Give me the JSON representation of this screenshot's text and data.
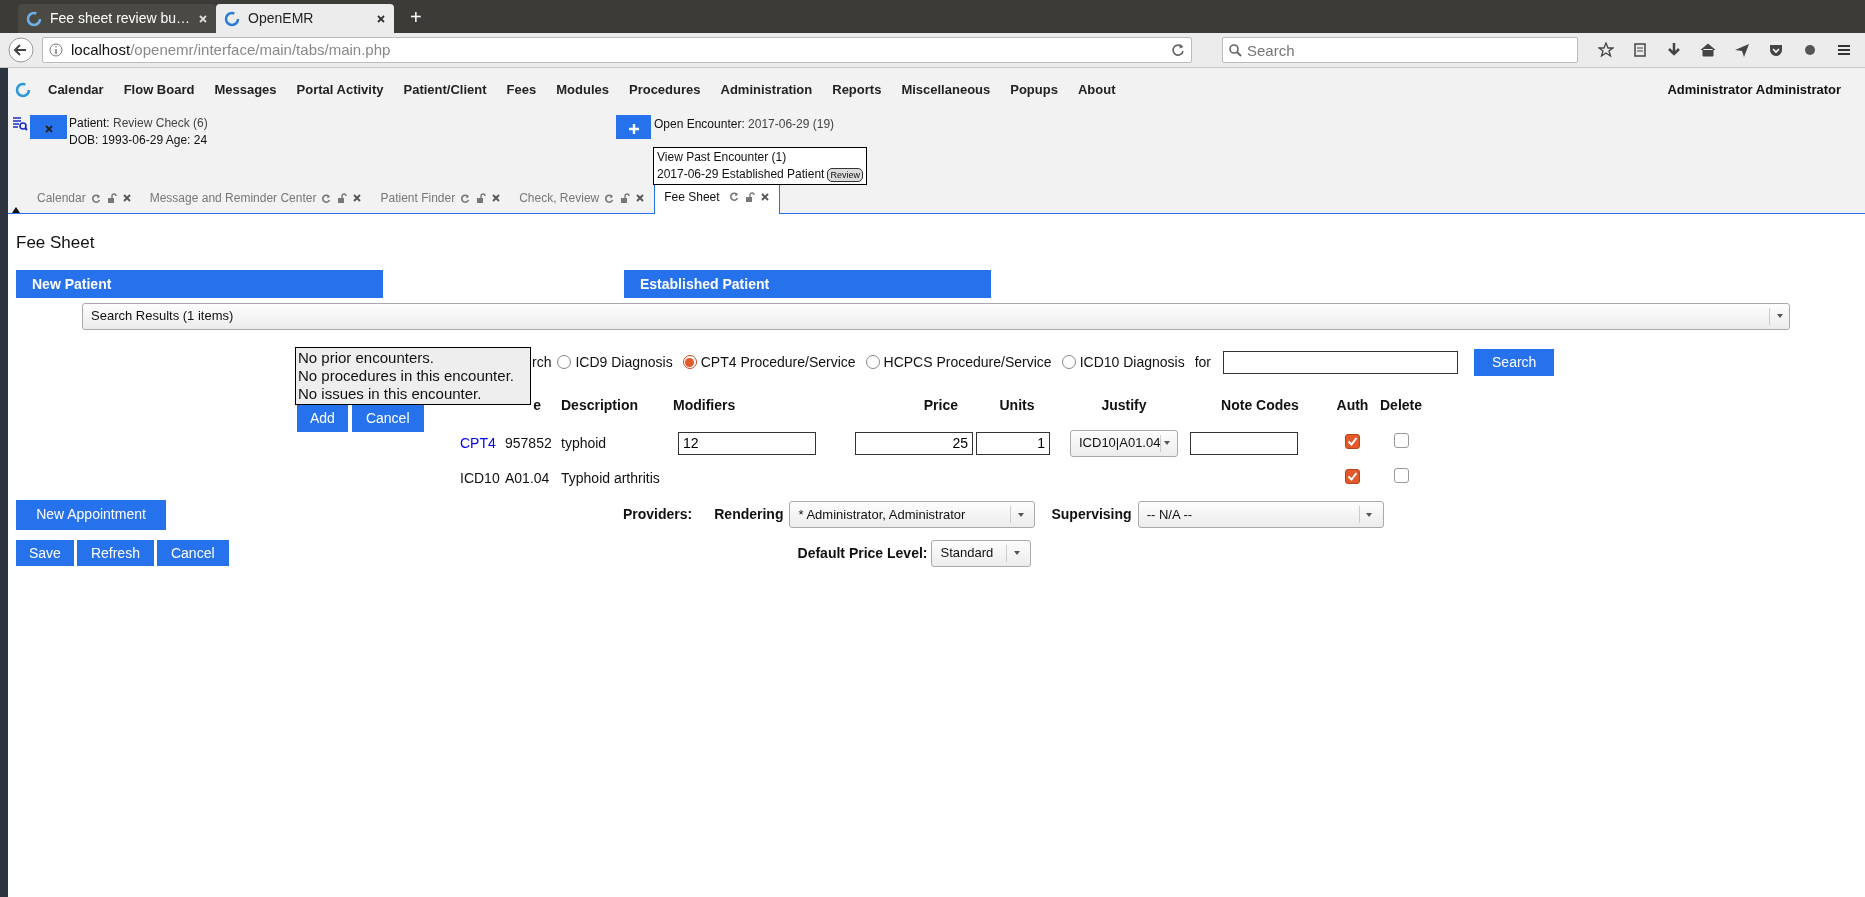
{
  "browser": {
    "tabs": [
      {
        "title": "Fee sheet review bu…",
        "selected": false
      },
      {
        "title": "OpenEMR",
        "selected": true
      }
    ],
    "new_tab": "+",
    "url": {
      "host": "localhost",
      "path": "/openemr/interface/main/tabs/main.php"
    },
    "search": {
      "placeholder": "Search"
    }
  },
  "menu": {
    "items": [
      "Calendar",
      "Flow Board",
      "Messages",
      "Portal Activity",
      "Patient/Client",
      "Fees",
      "Modules",
      "Procedures",
      "Administration",
      "Reports",
      "Miscellaneous",
      "Popups",
      "About"
    ],
    "user": "Administrator Administrator"
  },
  "patient": {
    "label": "Patient:",
    "name": "Review Check (6)",
    "dob": "DOB: 1993-06-29 Age: 24"
  },
  "encounter": {
    "label": "Open Encounter:",
    "value": "2017-06-29 (19)",
    "popup": {
      "past": "View Past Encounter (1)",
      "entry": "2017-06-29 Established Patient",
      "review": "Review"
    }
  },
  "app_tabs": [
    {
      "label": "Calendar",
      "selected": false
    },
    {
      "label": "Message and Reminder Center",
      "selected": false
    },
    {
      "label": "Patient Finder",
      "selected": false
    },
    {
      "label": "Check, Review",
      "selected": false
    },
    {
      "label": "Fee Sheet",
      "selected": true
    }
  ],
  "fee_sheet": {
    "title": "Fee Sheet",
    "categories": [
      "New Patient",
      "Established Patient"
    ],
    "search_results": "Search Results (1 items)",
    "overlay": {
      "lines": [
        "No prior encounters.",
        "No procedures in this encounter.",
        "No issues in this encounter."
      ],
      "buttons": [
        "Add",
        "Cancel"
      ]
    },
    "search": {
      "label": "rch",
      "options": [
        {
          "label": "ICD9 Diagnosis",
          "selected": false
        },
        {
          "label": "CPT4 Procedure/Service",
          "selected": true
        },
        {
          "label": "HCPCS Procedure/Service",
          "selected": false
        },
        {
          "label": "ICD10 Diagnosis",
          "selected": false
        }
      ],
      "for_label": "for",
      "button": "Search"
    },
    "table": {
      "columns": [
        "e",
        "Description",
        "Modifiers",
        "Price",
        "Units",
        "Justify",
        "Note Codes",
        "Auth",
        "Delete"
      ],
      "rows": [
        {
          "kind": "procedure",
          "type": "CPT4",
          "code": "957852",
          "description": "typhoid",
          "modifiers": "12",
          "price": "25",
          "units": "1",
          "justify": "ICD10|A01.04",
          "auth": true,
          "delete": false
        },
        {
          "kind": "diagnosis",
          "type": "ICD10",
          "code": "A01.04",
          "description": "Typhoid arthritis",
          "auth": true,
          "delete": false
        }
      ]
    },
    "new_appointment": "New Appointment",
    "providers": {
      "label": "Providers:",
      "rendering_label": "Rendering",
      "rendering": "* Administrator, Administrator",
      "supervising_label": "Supervising",
      "supervising": "-- N/A --"
    },
    "price_level": {
      "label": "Default Price Level:",
      "value": "Standard"
    },
    "buttons": [
      "Save",
      "Refresh",
      "Cancel"
    ]
  }
}
